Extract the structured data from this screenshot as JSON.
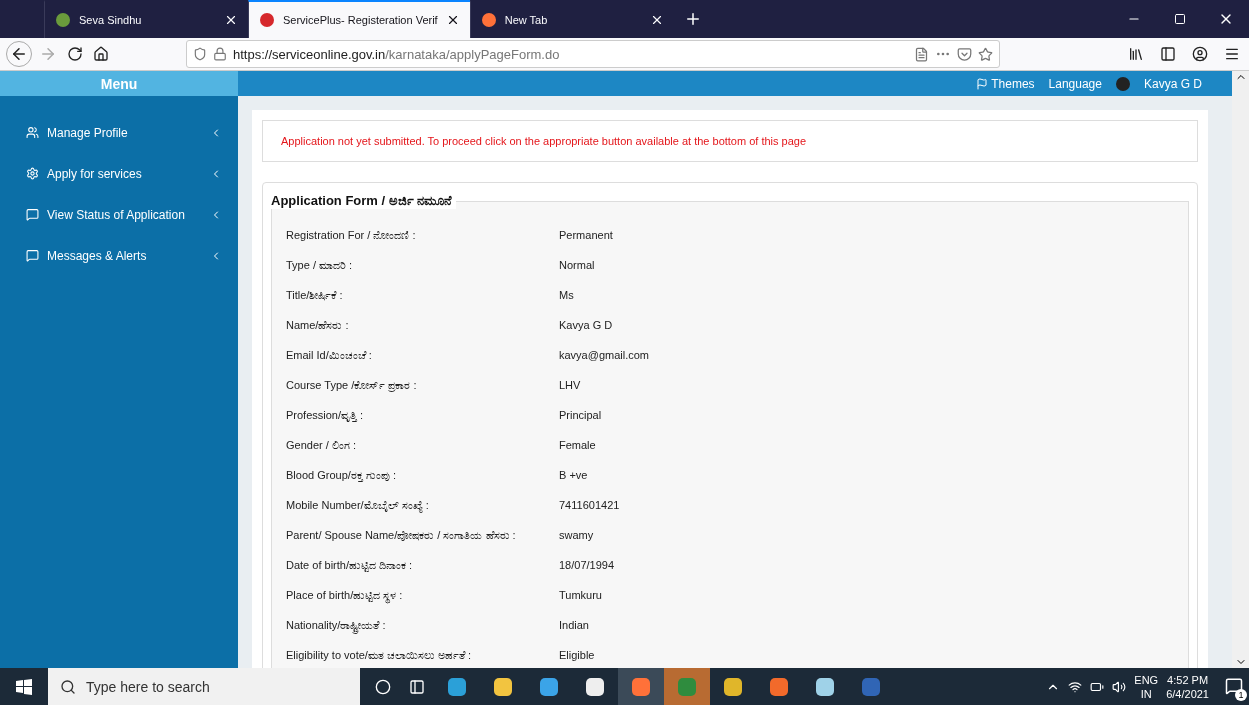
{
  "browser": {
    "tabs": [
      {
        "title": "Seva Sindhu",
        "selected": false
      },
      {
        "title": "ServicePlus- Registeration Verif",
        "selected": true
      },
      {
        "title": "New Tab",
        "selected": false
      }
    ],
    "url": {
      "host": "https://serviceonline.gov.in",
      "path": "/karnataka/applyPageForm.do"
    }
  },
  "header": {
    "menu_title": "Menu",
    "links": [
      "Themes",
      "Language"
    ],
    "user": "Kavya G D"
  },
  "sidebar": {
    "items": [
      {
        "label": "Manage Profile"
      },
      {
        "label": "Apply for services"
      },
      {
        "label": "View Status of Application"
      },
      {
        "label": "Messages & Alerts"
      }
    ]
  },
  "alert": "Application not yet submitted. To proceed click on the appropriate button available at the bottom of this page",
  "form": {
    "title": "Application Form / ಅರ್ಜಿ ನಮೂನೆ",
    "fields": [
      {
        "label": "Registration For / ನೋಂದಣಿ :",
        "value": "Permanent"
      },
      {
        "label": "Type / ಮಾದರಿ :",
        "value": "Normal"
      },
      {
        "label": "Title/ಶೀರ್ಷಿಕೆ :",
        "value": "Ms"
      },
      {
        "label": "Name/ಹೆಸರು :",
        "value": "Kavya G D"
      },
      {
        "label": "Email Id/ಮಿಂಚಂಚೆ :",
        "value": "kavya@gmail.com"
      },
      {
        "label": "Course Type /ಕೋರ್ಸ್ ಪ್ರಕಾರ :",
        "value": "LHV"
      },
      {
        "label": "Profession/ವೃತ್ತಿ :",
        "value": "Principal"
      },
      {
        "label": "Gender / ಲಿಂಗ :",
        "value": "Female"
      },
      {
        "label": "Blood Group/ರಕ್ತ ಗುಂಪು :",
        "value": "B +ve"
      },
      {
        "label": "Mobile Number/ಮೊಬೈಲ್ ಸಂಖ್ಯೆ :",
        "value": "7411601421"
      },
      {
        "label": "Parent/ Spouse Name/ಪೋಷಕರು / ಸಂಗಾತಿಯ ಹೆಸರು :",
        "value": "swamy"
      },
      {
        "label": "Date of birth/ಹುಟ್ಟಿದ ದಿನಾಂಕ :",
        "value": "18/07/1994"
      },
      {
        "label": "Place of birth/ಹುಟ್ಟಿದ ಸ್ಥಳ :",
        "value": "Tumkuru"
      },
      {
        "label": "Nationality/ರಾಷ್ಟ್ರೀಯತೆ :",
        "value": "Indian"
      },
      {
        "label": "Eligibility to vote/ಮತ ಚಲಾಯಿಸಲು ಅರ್ಹತೆ :",
        "value": "Eligible"
      }
    ]
  },
  "taskbar": {
    "search_placeholder": "Type here to search",
    "language": "ENG",
    "region": "IN",
    "time": "4:52 PM",
    "date": "6/4/2021",
    "notifications": "1"
  }
}
